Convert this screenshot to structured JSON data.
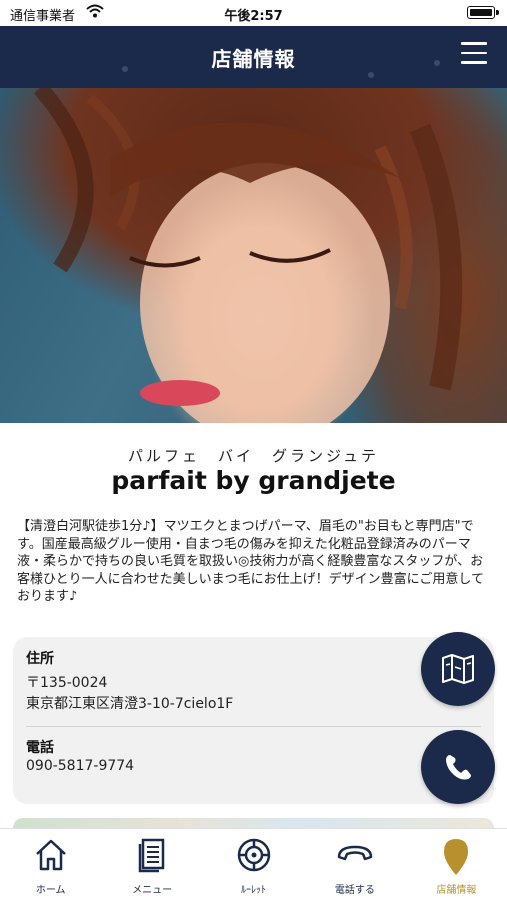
{
  "status_bar": {
    "carrier": "通信事業者",
    "time": "午後2:57"
  },
  "header": {
    "title": "店舗情報"
  },
  "shop": {
    "kana": "パルフェ　バイ　グランジュテ",
    "name": "parfait by grandjete",
    "description": "【清澄白河駅徒歩1分♪】マツエクとまつげパーマ、眉毛の\"お目もと専門店\"です。国産最高級グルー使用・自まつ毛の傷みを抑えた化粧品登録済みのパーマ液・柔らかで持ちの良い毛質を取扱い◎技術力が高く経験豊富なスタッフが、お客様ひとり一人に合わせた美しいまつ毛にお仕上げ！デザイン豊富にご用意しております♪"
  },
  "info": {
    "address_label": "住所",
    "postal": "〒135-0024",
    "address": "東京都江東区清澄3-10-7cielo1F",
    "phone_label": "電話",
    "phone": "090-5817-9774"
  },
  "tabs": [
    {
      "label": "ホーム",
      "icon": "home-icon",
      "active": false
    },
    {
      "label": "メニュー",
      "icon": "menu-book-icon",
      "active": false
    },
    {
      "label": "ﾙｰﾚｯﾄ",
      "icon": "roulette-icon",
      "active": false
    },
    {
      "label": "電話する",
      "icon": "phone-receiver-icon",
      "active": false
    },
    {
      "label": "店舗情報",
      "icon": "map-pin-icon",
      "active": true
    }
  ],
  "colors": {
    "navy": "#1b2a4a",
    "gold": "#b8912e",
    "card": "#f1f1f2"
  }
}
